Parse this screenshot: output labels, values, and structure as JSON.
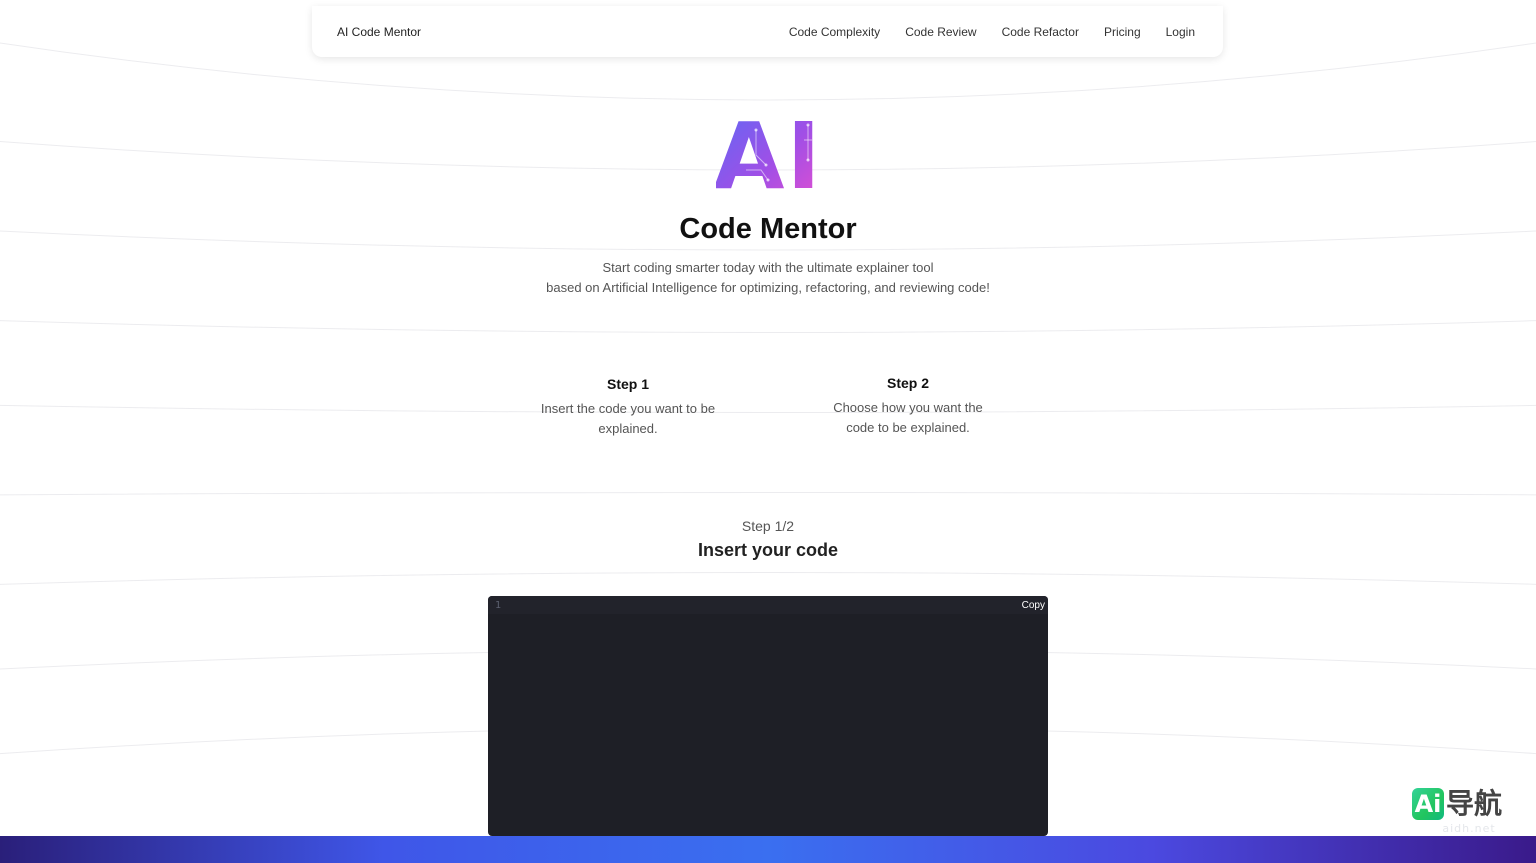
{
  "nav": {
    "brand": "AI Code Mentor",
    "links": [
      "Code Complexity",
      "Code Review",
      "Code Refactor",
      "Pricing",
      "Login"
    ]
  },
  "hero": {
    "logo_text": "AI",
    "title": "Code Mentor",
    "subtitle_line1": "Start coding smarter today with the ultimate explainer tool",
    "subtitle_line2": "based on Artificial Intelligence for optimizing, refactoring, and reviewing code!"
  },
  "steps": [
    {
      "title": "Step 1",
      "desc_line1": "Insert the code you want to be",
      "desc_line2": "explained."
    },
    {
      "title": "Step 2",
      "desc_line1": "Choose how you want the",
      "desc_line2": "code to be explained."
    }
  ],
  "wizard": {
    "counter": "Step 1/2",
    "title": "Insert your code"
  },
  "editor": {
    "line_number": "1",
    "copy_label": "Copy"
  },
  "watermark": {
    "logo_text": "Ai",
    "text": "导航",
    "url": "aidh.net"
  },
  "colors": {
    "logo_gradient_start": "#6a5cf6",
    "logo_gradient_end": "#e14fd8",
    "editor_bg": "#1e1f26",
    "bottom_bar": "#3f56e8"
  }
}
